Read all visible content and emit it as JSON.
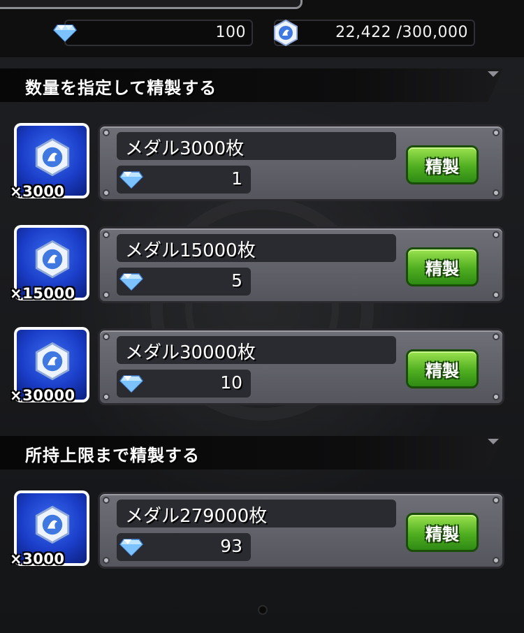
{
  "header": {
    "gem_count": "100",
    "medal_count": "22,422 /300,000"
  },
  "sections": [
    {
      "title": "数量を指定して精製する"
    },
    {
      "title": "所持上限まで精製する"
    }
  ],
  "rows": [
    {
      "qty_label": "×3000",
      "name": "メダル3000枚",
      "cost": "1",
      "button": "精製"
    },
    {
      "qty_label": "×15000",
      "name": "メダル15000枚",
      "cost": "5",
      "button": "精製"
    },
    {
      "qty_label": "×30000",
      "name": "メダル30000枚",
      "cost": "10",
      "button": "精製"
    },
    {
      "qty_label": "×3000",
      "name": "メダル279000枚",
      "cost": "93",
      "button": "精製"
    }
  ],
  "icons": {
    "gem": "diamond-gem-icon",
    "medal": "medal-icon"
  },
  "colors": {
    "refine_button": "#4fae20",
    "icon_bg": "#1b3ec9",
    "panel": "#5f6068"
  }
}
